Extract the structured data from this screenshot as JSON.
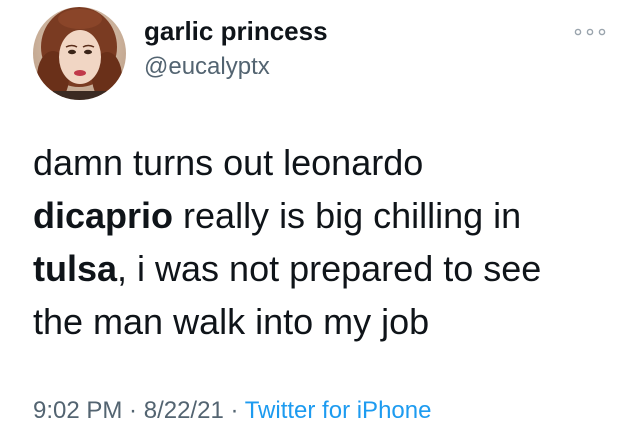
{
  "tweet": {
    "author": {
      "display_name": "garlic princess",
      "handle": "@eucalyptx"
    },
    "text": {
      "line1": "damn turns out leonardo",
      "line2_bold": "dicaprio",
      "line2_rest": " really is big chilling in",
      "line3_bold": "tulsa",
      "line3_rest": ", i was not prepared to see",
      "line4": "the man walk into my job"
    },
    "meta": {
      "time": "9:02 PM",
      "separator1": " · ",
      "date": "8/22/21",
      "separator2": " · ",
      "source": "Twitter for iPhone"
    },
    "icons": {
      "more": "more-dots-icon",
      "avatar": "avatar-photo"
    },
    "colors": {
      "text": "#0f1419",
      "secondary": "#536471",
      "link": "#1d9bf0"
    }
  }
}
